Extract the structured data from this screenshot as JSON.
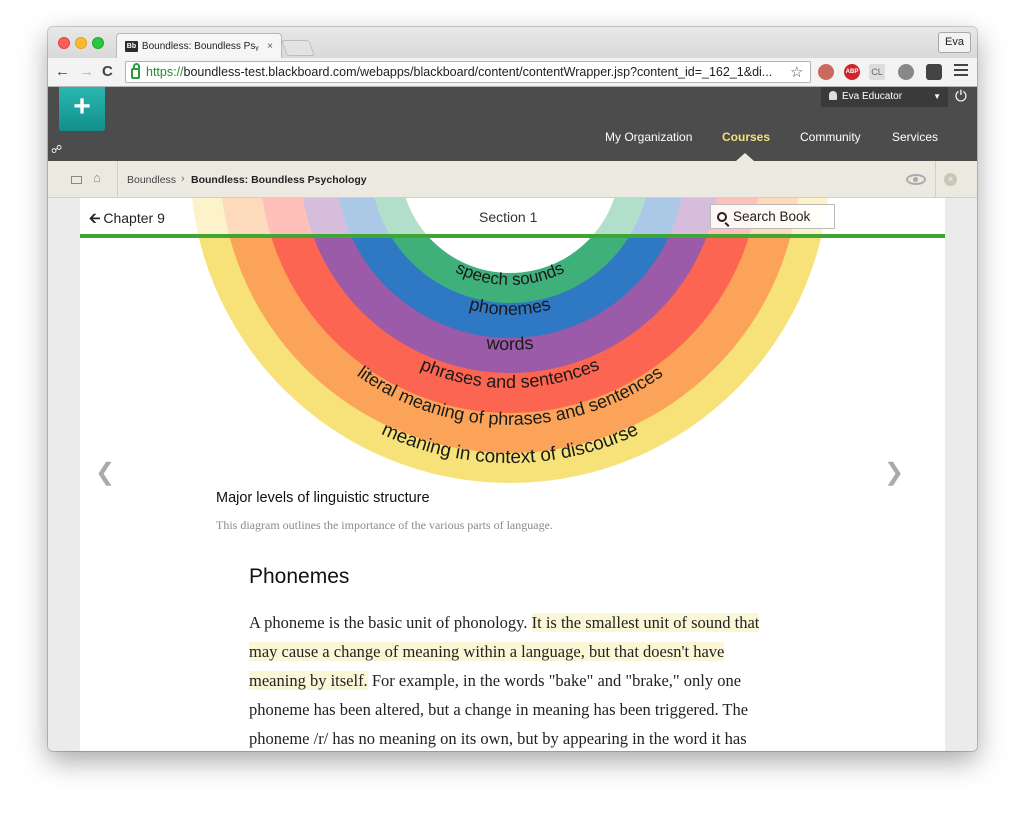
{
  "browser": {
    "tab_title": "Boundless: Boundless Psᵧ",
    "tab_close": "×",
    "profile_name": "Eva",
    "url_scheme": "https://",
    "url_rest": "boundless-test.blackboard.com/webapps/blackboard/content/contentWrapper.jsp?content_id=_162_1&di...",
    "ext_abp": "ABP",
    "ext_cl": "CL"
  },
  "header": {
    "logo": "+",
    "user_name": "Eva Educator",
    "nav": {
      "organization": "My Organization",
      "courses": "Courses",
      "community": "Community",
      "services": "Services"
    }
  },
  "breadcrumb": {
    "item1": "Boundless",
    "separator": "›",
    "item2": "Boundless: Boundless Psychology"
  },
  "book": {
    "back_label": "Chapter 9",
    "section_label": "Section 1",
    "search_label": "Search Book"
  },
  "diagram": {
    "rings": [
      {
        "label": "meaning in context of discourse",
        "color": "#f7e27a"
      },
      {
        "label": "literal meaning of phrases and sentences",
        "color": "#fba459"
      },
      {
        "label": "phrases and sentences",
        "color": "#fb6551"
      },
      {
        "label": "words",
        "color": "#9b5ba8"
      },
      {
        "label": "phonemes",
        "color": "#2f78c4"
      },
      {
        "label": "speech sounds",
        "color": "#3fb07a"
      }
    ]
  },
  "figure": {
    "title": "Major levels of linguistic structure",
    "caption": "This diagram outlines the importance of the various parts of language."
  },
  "article": {
    "heading": "Phonemes",
    "text_before": "A phoneme is the basic unit of phonology. ",
    "text_highlight": "It is the smallest unit of sound that may cause a change of meaning within a language, but that doesn't have meaning by itself.",
    "text_after": " For example, in the words \"bake\" and \"brake,\" only one phoneme has been altered, but a change in meaning has been triggered. The phoneme /r/ has no meaning on its own, but by appearing in the word it has completely changed the word's meaning!"
  }
}
